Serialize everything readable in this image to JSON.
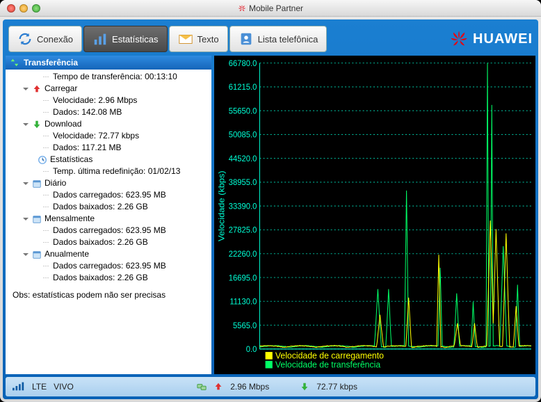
{
  "window": {
    "title": "Mobile Partner"
  },
  "toolbar": {
    "connection": "Conexão",
    "stats": "Estatísticas",
    "text": "Texto",
    "phonebook": "Lista telefônica"
  },
  "brand": "HUAWEI",
  "tree": {
    "title": "Transferência",
    "transfer_time_label": "Tempo de transferência: ",
    "transfer_time_value": "00:13:10",
    "upload_label": "Carregar",
    "upload_speed": "Velocidade: 2.96 Mbps",
    "upload_data": "Dados: 142.08 MB",
    "download_label": "Download",
    "download_speed": "Velocidade: 72.77 kbps",
    "download_data": "Dados: 117.21 MB",
    "stats_label": "Estatísticas",
    "last_reset": "Temp. última redefinição: 01/02/13",
    "daily_label": "Diário",
    "daily_up": "Dados carregados: 623.95 MB",
    "daily_down": "Dados baixados: 2.26 GB",
    "monthly_label": "Mensalmente",
    "monthly_up": "Dados carregados: 623.95 MB",
    "monthly_down": "Dados baixados: 2.26 GB",
    "yearly_label": "Anualmente",
    "yearly_up": "Dados carregados: 623.95 MB",
    "yearly_down": "Dados baixados: 2.26 GB",
    "note": "Obs: estatísticas podem não ser precisas"
  },
  "chart_data": {
    "type": "line",
    "ylabel": "Velocidade (kbps)",
    "ylim": [
      0,
      66780
    ],
    "yticks": [
      0,
      5565,
      11130,
      16695,
      22260,
      27825,
      33390,
      38955,
      44520,
      50085,
      55650,
      61215,
      66780
    ],
    "series": [
      {
        "name": "Velocidade de carregamento",
        "color": "#ffff00"
      },
      {
        "name": "Velocidade de transferência",
        "color": "#00ff66"
      }
    ],
    "legend": {
      "upload": "Velocidade de carregamento",
      "download": "Velocidade de transferência"
    }
  },
  "status": {
    "network": "LTE",
    "carrier": "VIVO",
    "up_speed": "2.96 Mbps",
    "down_speed": "72.77 kbps"
  }
}
